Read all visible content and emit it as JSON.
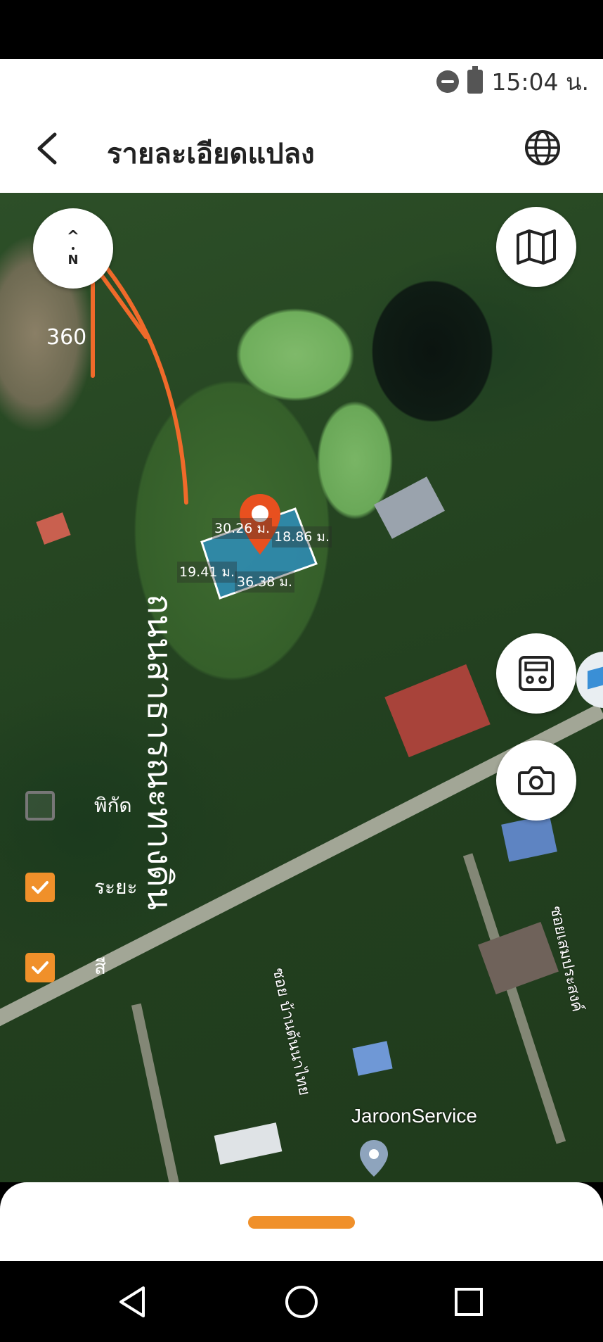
{
  "status_bar": {
    "time": "15:04 น.",
    "icons": [
      "do-not-disturb-icon",
      "battery-charging-icon"
    ]
  },
  "header": {
    "title": "รายละเอียดแปลง",
    "back_icon": "chevron-left-icon",
    "language_icon": "globe-icon"
  },
  "map": {
    "compass": {
      "arrow": "^",
      "letter": "N"
    },
    "bearing": "360",
    "parcel": {
      "pin_color": "#e8501f",
      "fill_color": "#2d8fbf",
      "dimensions": {
        "top": "30.26 ม.",
        "right": "18.86 ม.",
        "left": "19.41 ม.",
        "bottom": "36.38 ม."
      }
    },
    "handwritten_road_label": "ถนนสาธารณะทางดิน",
    "road_names": {
      "soi_1": "ซอย บ้านต้นนาไทย",
      "soi_2": "ซอยเสมประสงค์"
    },
    "place_label": "JaroonService",
    "layers": [
      {
        "label": "พิกัด",
        "checked": false
      },
      {
        "label": "ระยะ",
        "checked": true
      },
      {
        "label": "สี",
        "checked": true
      }
    ],
    "buttons": {
      "map_type_icon": "map-icon",
      "calculator_icon": "calculator-icon",
      "camera_icon": "camera-icon"
    }
  },
  "accent_color": "#f0902a",
  "nav_bar": {
    "icons": [
      "back-triangle-icon",
      "home-circle-icon",
      "recents-square-icon"
    ]
  }
}
